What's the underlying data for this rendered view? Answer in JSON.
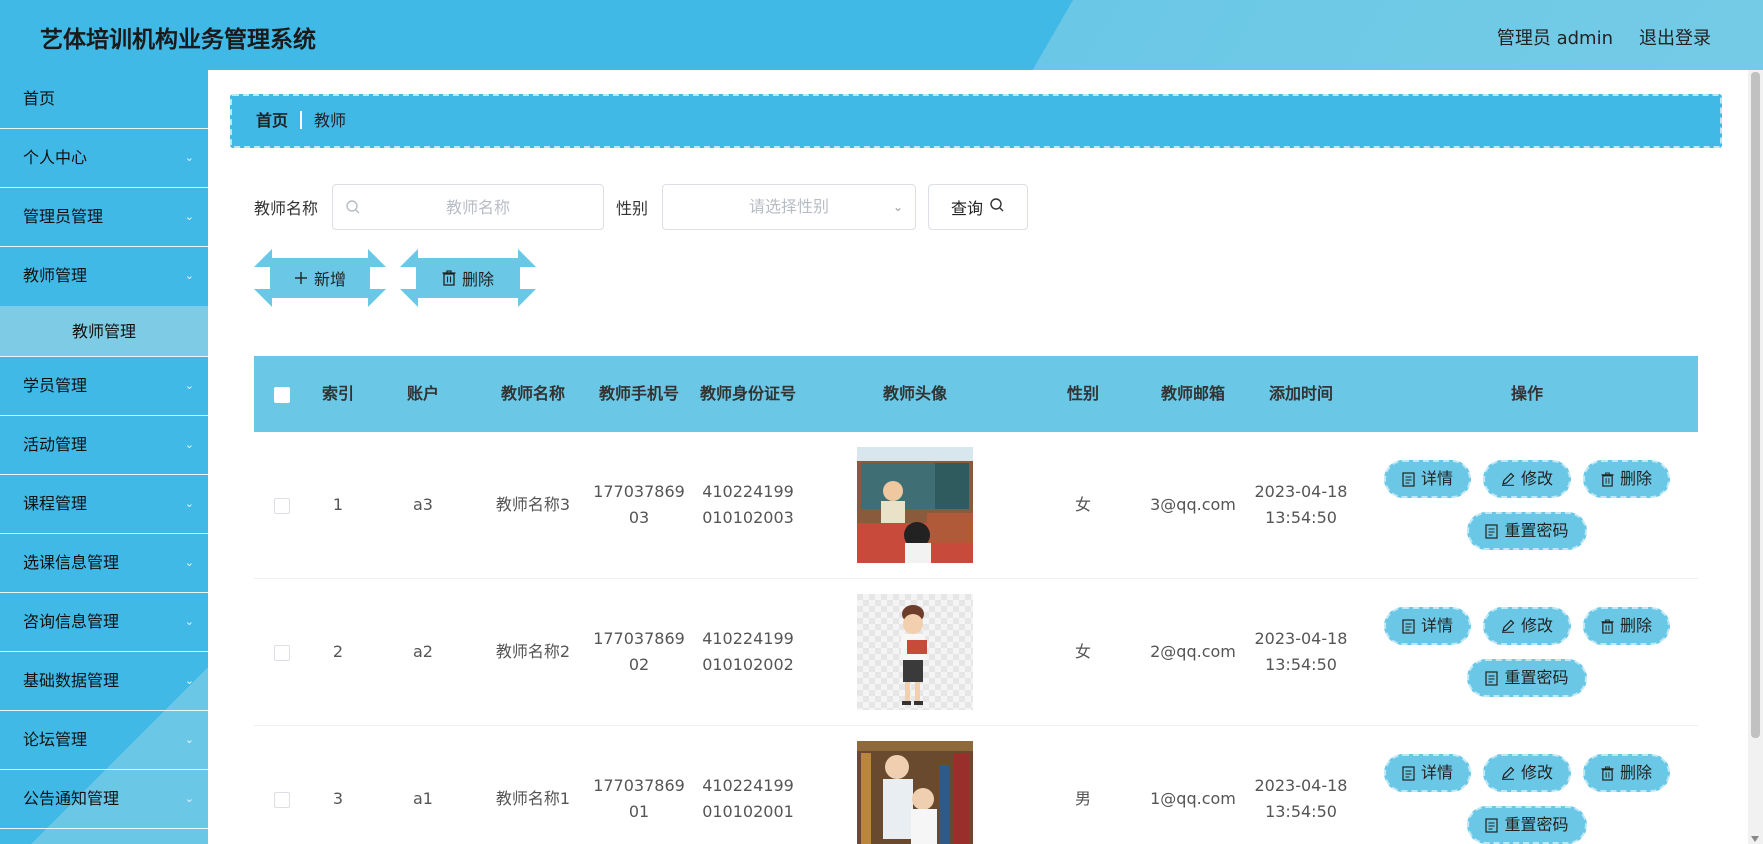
{
  "header": {
    "title": "艺体培训机构业务管理系统",
    "user": "管理员 admin",
    "logout": "退出登录"
  },
  "sidebar": {
    "items": [
      {
        "label": "首页"
      },
      {
        "label": "个人中心"
      },
      {
        "label": "管理员管理"
      },
      {
        "label": "教师管理"
      },
      {
        "label": "学员管理"
      },
      {
        "label": "活动管理"
      },
      {
        "label": "课程管理"
      },
      {
        "label": "选课信息管理"
      },
      {
        "label": "咨询信息管理"
      },
      {
        "label": "基础数据管理"
      },
      {
        "label": "论坛管理"
      },
      {
        "label": "公告通知管理"
      }
    ],
    "submenu_label": "教师管理"
  },
  "breadcrumb": {
    "home": "首页",
    "current": "教师"
  },
  "search": {
    "name_label": "教师名称",
    "name_placeholder": "教师名称",
    "gender_label": "性别",
    "gender_placeholder": "请选择性别",
    "query_label": "查询"
  },
  "actions": {
    "add_label": "新增",
    "delete_label": "删除"
  },
  "table": {
    "columns": [
      "索引",
      "账户",
      "教师名称",
      "教师手机号",
      "教师身份证号",
      "教师头像",
      "性别",
      "教师邮箱",
      "添加时间",
      "操作"
    ],
    "rows": [
      {
        "index": "1",
        "account": "a3",
        "name": "教师名称3",
        "phone_a": "177037869",
        "phone_b": "03",
        "id_a": "410224199",
        "id_b": "010102003",
        "gender": "女",
        "email": "3@qq.com",
        "date": "2023-04-18",
        "time": "13:54:50"
      },
      {
        "index": "2",
        "account": "a2",
        "name": "教师名称2",
        "phone_a": "177037869",
        "phone_b": "02",
        "id_a": "410224199",
        "id_b": "010102002",
        "gender": "女",
        "email": "2@qq.com",
        "date": "2023-04-18",
        "time": "13:54:50"
      },
      {
        "index": "3",
        "account": "a1",
        "name": "教师名称1",
        "phone_a": "177037869",
        "phone_b": "01",
        "id_a": "410224199",
        "id_b": "010102001",
        "gender": "男",
        "email": "1@qq.com",
        "date": "2023-04-18",
        "time": "13:54:50"
      }
    ],
    "ops": {
      "detail": "详情",
      "edit": "修改",
      "delete": "删除",
      "reset_password": "重置密码"
    }
  },
  "colors": {
    "primary": "#40b9e6",
    "secondary": "#6ac8e6",
    "accent_light": "#bfe8f7"
  }
}
